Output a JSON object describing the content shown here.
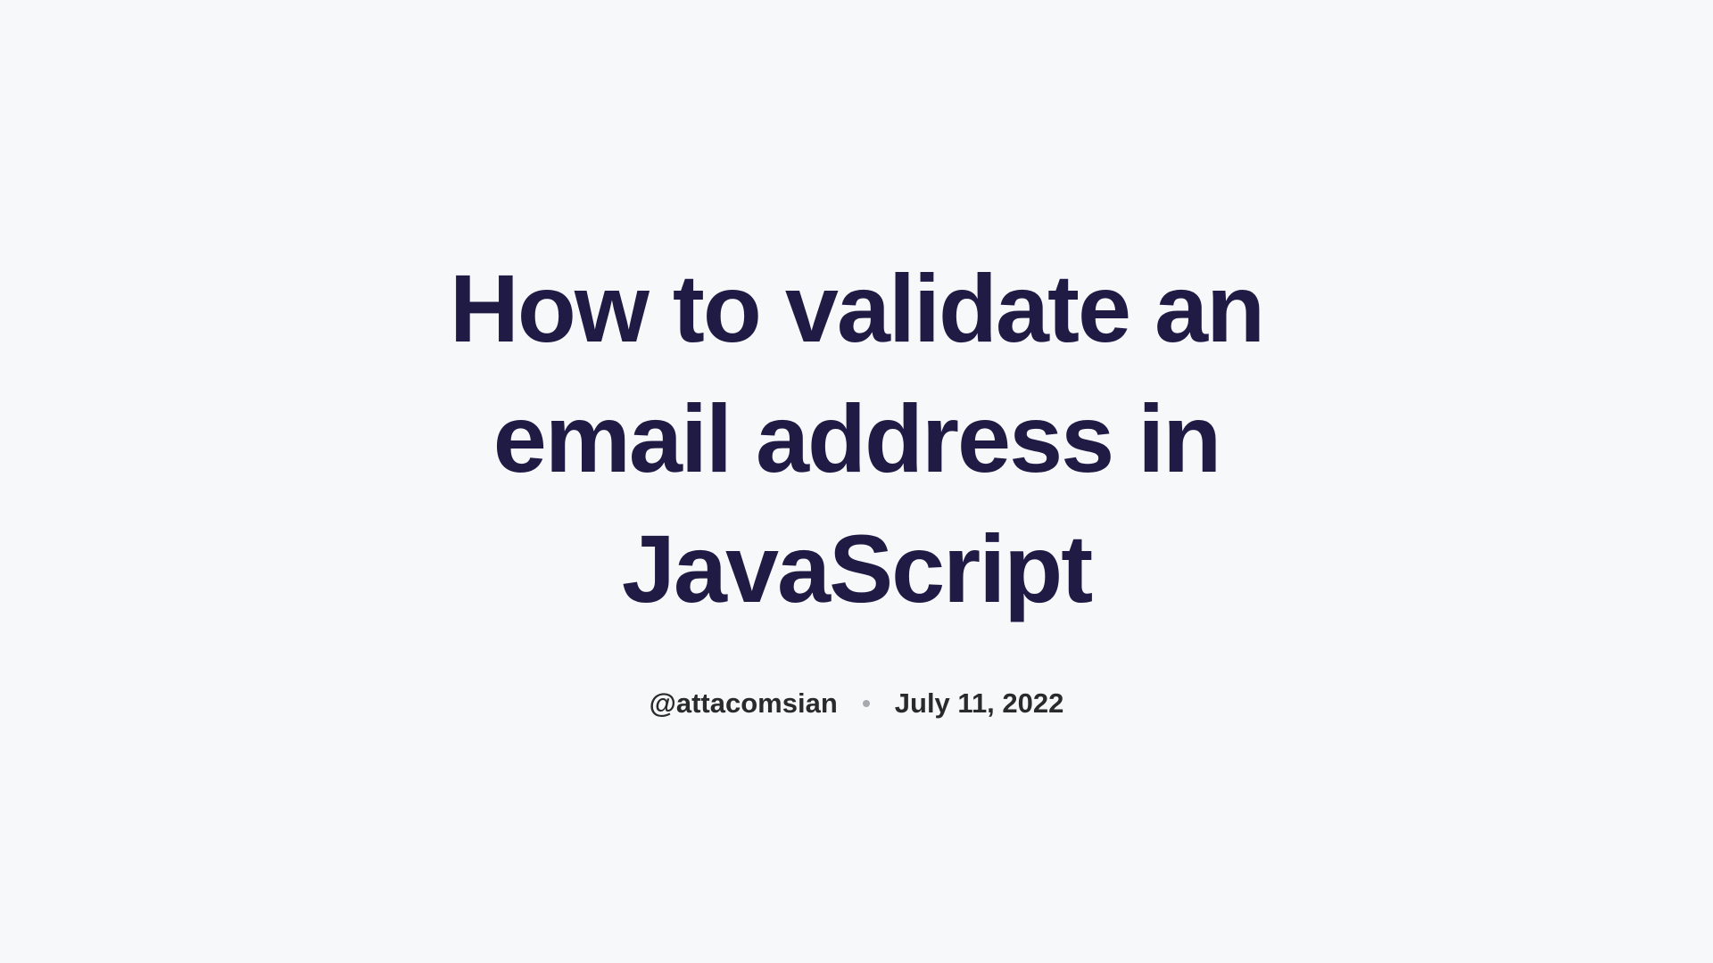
{
  "title": "How to validate an email address in JavaScript",
  "author": "@attacomsian",
  "date": "July 11, 2022"
}
